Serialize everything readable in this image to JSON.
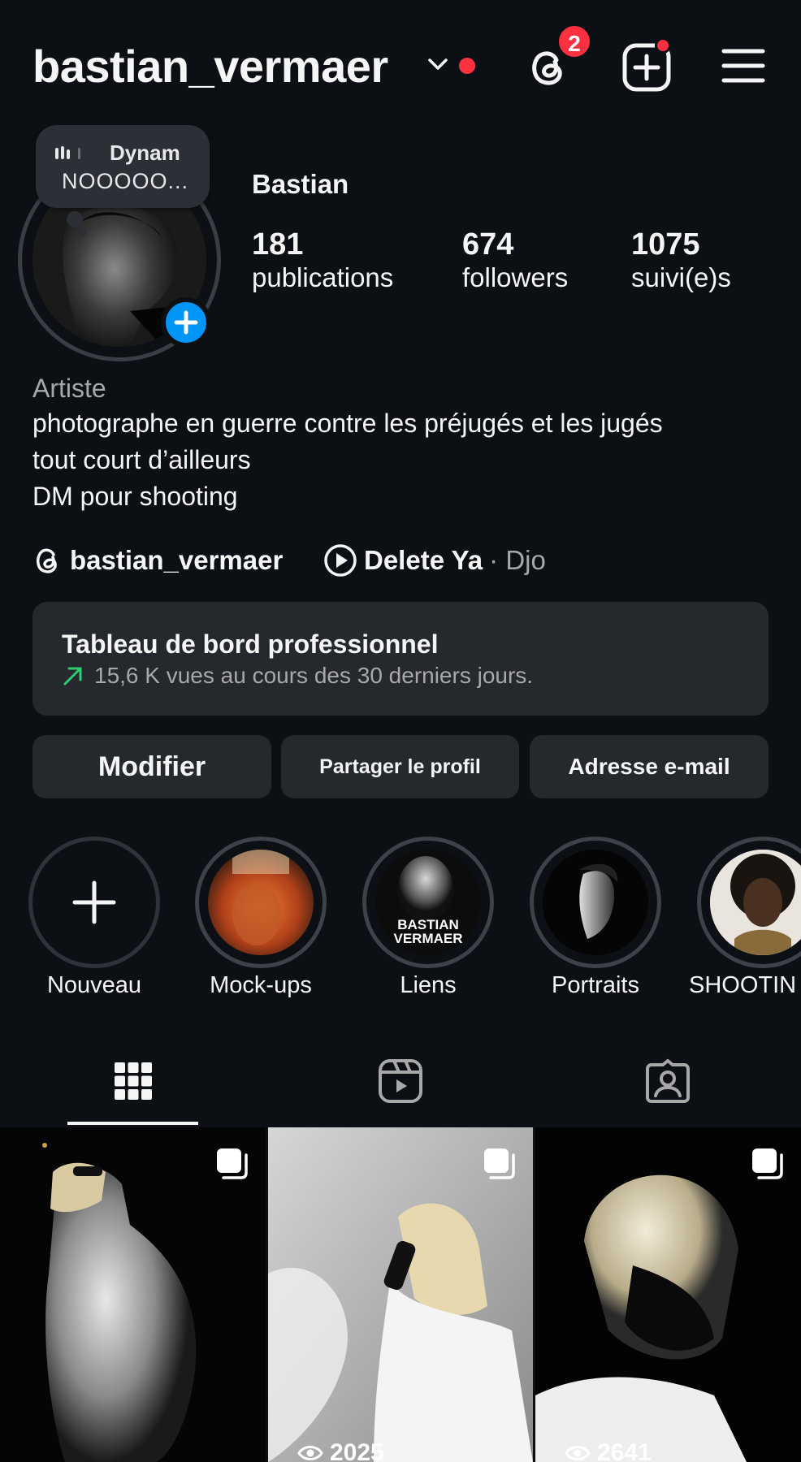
{
  "header": {
    "username": "bastian_vermaer",
    "threads_badge": "2",
    "icons": [
      "chevron-down-icon",
      "threads-icon",
      "new-post-icon",
      "menu-icon"
    ]
  },
  "note": {
    "title": "Dynam",
    "text": "NOOOOO..."
  },
  "profile": {
    "display_name": "Bastian",
    "stats": [
      {
        "value": "181",
        "label": "publications"
      },
      {
        "value": "674",
        "label": "followers"
      },
      {
        "value": "1075",
        "label": "suivi(e)s"
      }
    ],
    "category": "Artiste",
    "bio": [
      "photographe en guerre contre les préjugés et les jugés",
      "tout court d’ailleurs",
      "DM pour shooting"
    ],
    "threads_handle": "bastian_vermaer",
    "music": {
      "song": "Delete Ya",
      "artist": "· Djo"
    }
  },
  "dashboard": {
    "title": "Tableau de bord professionnel",
    "subtitle": "15,6 K vues au cours des 30 derniers jours.",
    "accent": "#2ecc71"
  },
  "buttons": {
    "edit": "Modifier",
    "share": "Partager le profil",
    "email": "Adresse e-mail"
  },
  "highlights": [
    {
      "label": "Nouveau"
    },
    {
      "label": "Mock-ups"
    },
    {
      "label": "Liens",
      "overlay_text": "BASTIAN VERMAER"
    },
    {
      "label": "Portraits"
    },
    {
      "label": "SHOOTIN"
    }
  ],
  "posts": [
    {
      "views": ""
    },
    {
      "views": "2025"
    },
    {
      "views": "2641"
    }
  ],
  "colors": {
    "background": "#0c1014",
    "surface": "#25292e",
    "notification": "#ff3040",
    "primary": "#0095f6",
    "muted_text": "#a8a8a8"
  }
}
